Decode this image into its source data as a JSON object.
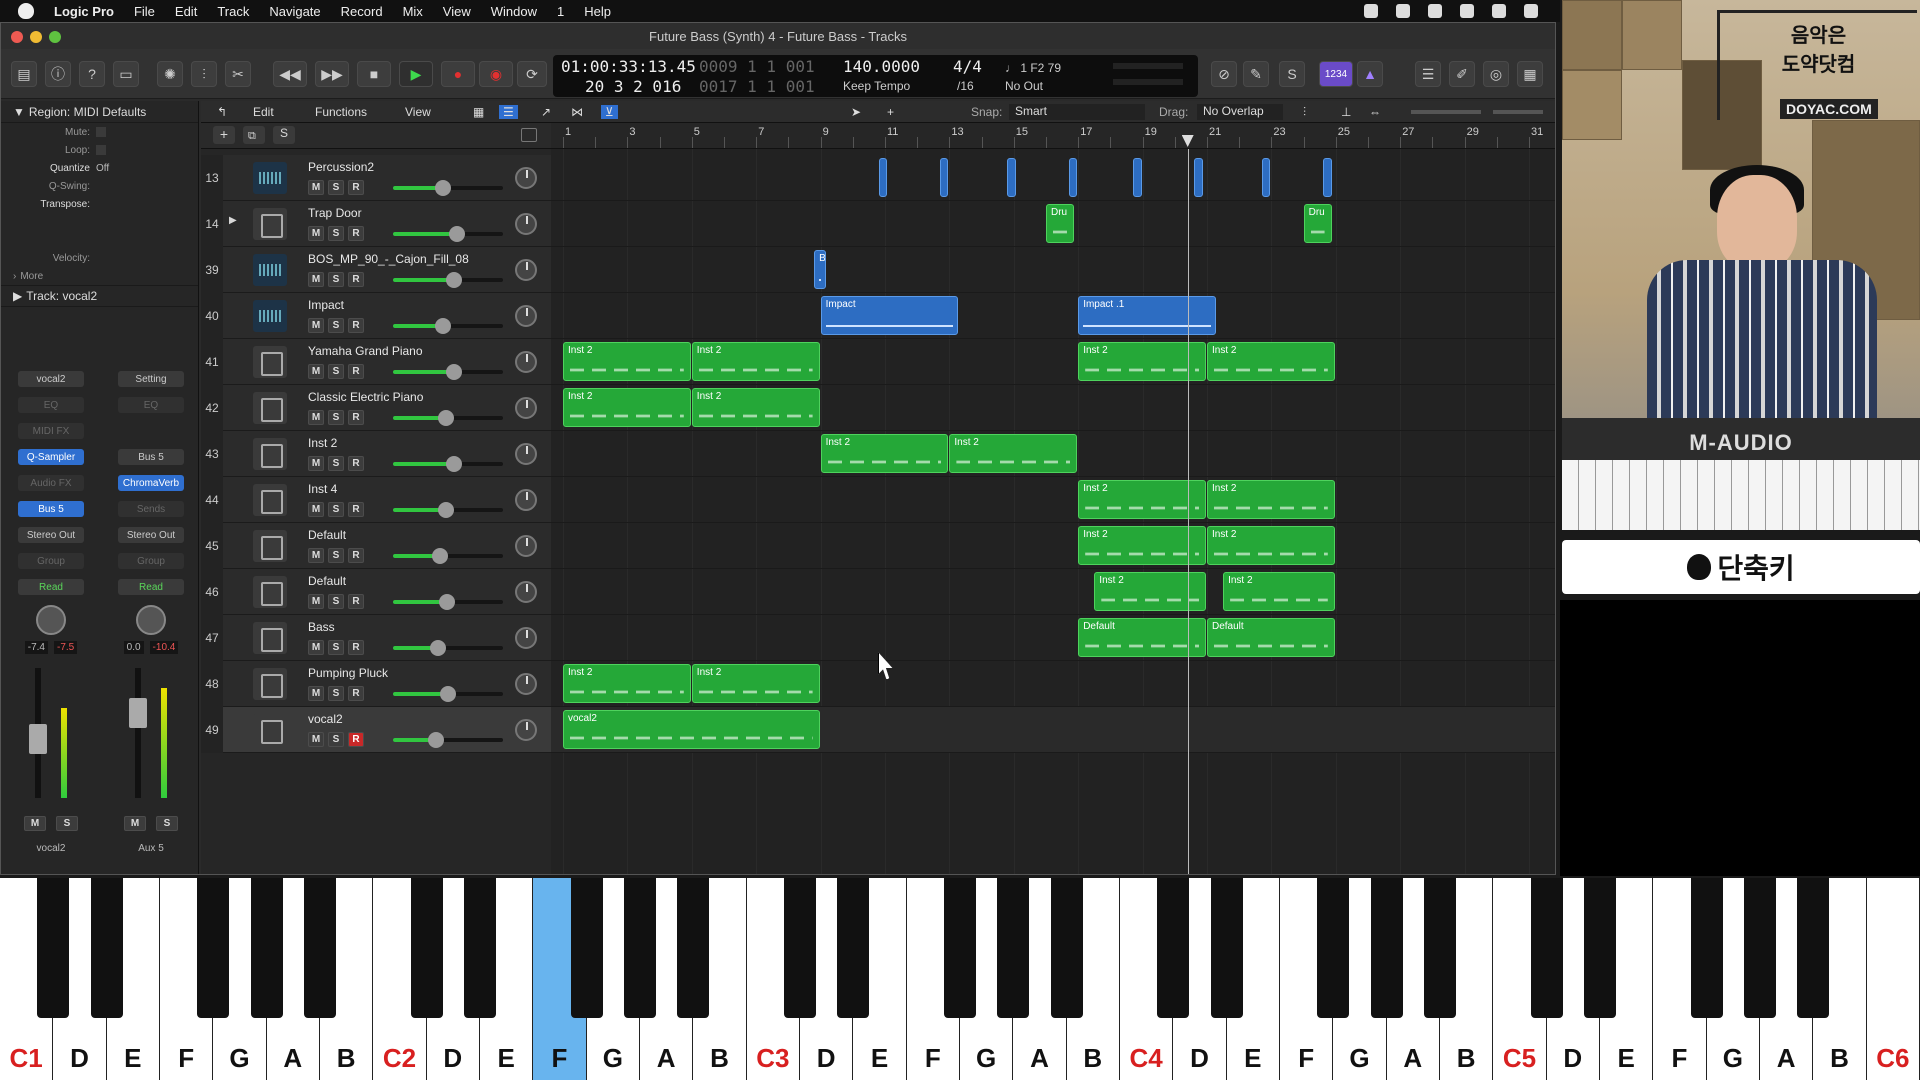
{
  "menubar": {
    "app": "Logic Pro",
    "items": [
      "File",
      "Edit",
      "Track",
      "Navigate",
      "Record",
      "Mix",
      "View",
      "Window",
      "1",
      "Help"
    ]
  },
  "window": {
    "title": "Future Bass (Synth) 4 - Future Bass - Tracks"
  },
  "lcd": {
    "smpte": "01:00:33:13.45",
    "bars_dim": "0009 1 1 001",
    "position": "20 3 2 016",
    "end_dim": "0017 1 1 001",
    "tempo": "140.0000",
    "tempo_mode": "Keep Tempo",
    "time_sig": "4/4",
    "division": "/16",
    "note_info": "♩ 1 F2 79",
    "midi_out": "No Out"
  },
  "toolbar": {
    "count_in": "1234"
  },
  "inspector": {
    "region_header": "Region: MIDI Defaults",
    "rows": [
      {
        "label": "Mute:",
        "value": ""
      },
      {
        "label": "Loop:",
        "value": ""
      },
      {
        "label": "Quantize",
        "value": "Off"
      },
      {
        "label": "Q-Swing:",
        "value": ""
      },
      {
        "label": "Transpose:",
        "value": ""
      },
      {
        "label": "Velocity:",
        "value": ""
      }
    ],
    "more": "More",
    "track_header": "Track:  vocal2",
    "strip_left": {
      "setting": "vocal2",
      "eq": "EQ",
      "midifx": "MIDI FX",
      "instrument": "Q-Sampler",
      "audiofx": "Audio FX",
      "send": "Bus 5",
      "output": "Stereo Out",
      "group": "Group",
      "automation": "Read",
      "vol": "-7.4",
      "peak": "-7.5",
      "m": "M",
      "s": "S",
      "name": "vocal2"
    },
    "strip_right": {
      "setting": "Setting",
      "eq": "EQ",
      "input": "Bus 5",
      "plugin": "ChromaVerb",
      "sends": "Sends",
      "output": "Stereo Out",
      "group": "Group",
      "automation": "Read",
      "vol": "0.0",
      "peak": "-10.4",
      "m": "M",
      "s": "S",
      "name": "Aux 5"
    }
  },
  "track_toolbar": {
    "edit": "Edit",
    "functions": "Functions",
    "view": "View",
    "snap_label": "Snap:",
    "snap_value": "Smart",
    "drag_label": "Drag:",
    "drag_value": "No Overlap"
  },
  "header_buttons": {
    "add": "+",
    "s": "S"
  },
  "ruler": {
    "bars": [
      "1",
      "3",
      "5",
      "7",
      "9",
      "11",
      "13",
      "15",
      "17",
      "19",
      "21",
      "23",
      "25",
      "27",
      "29",
      "31"
    ]
  },
  "tracks": [
    {
      "num": "13",
      "name": "Percussion2",
      "icon": "audio-waveform-icon",
      "fader": 0.45,
      "rec": false,
      "selected": false
    },
    {
      "num": "14",
      "name": "Trap Door",
      "icon": "drum-machine-icon",
      "fader": 0.58,
      "rec": false,
      "selected": false,
      "folder": true
    },
    {
      "num": "39",
      "name": "BOS_MP_90_-_Cajon_Fill_08",
      "icon": "audio-waveform-icon",
      "fader": 0.55,
      "rec": false,
      "selected": false
    },
    {
      "num": "40",
      "name": "Impact",
      "icon": "audio-waveform-icon",
      "fader": 0.45,
      "rec": false,
      "selected": false
    },
    {
      "num": "41",
      "name": "Yamaha Grand Piano",
      "icon": "grand-piano-icon",
      "fader": 0.55,
      "rec": false,
      "selected": false
    },
    {
      "num": "42",
      "name": "Classic Electric Piano",
      "icon": "electric-piano-icon",
      "fader": 0.48,
      "rec": false,
      "selected": false
    },
    {
      "num": "43",
      "name": "Inst 2",
      "icon": "synth-stand-icon",
      "fader": 0.55,
      "rec": false,
      "selected": false
    },
    {
      "num": "44",
      "name": "Inst 4",
      "icon": "synth-stand-icon",
      "fader": 0.48,
      "rec": false,
      "selected": false
    },
    {
      "num": "45",
      "name": "Default",
      "icon": "synth-stand-icon",
      "fader": 0.43,
      "rec": false,
      "selected": false
    },
    {
      "num": "46",
      "name": "Default",
      "icon": "synth-stand-icon",
      "fader": 0.49,
      "rec": false,
      "selected": false
    },
    {
      "num": "47",
      "name": "Bass",
      "icon": "synth-stand-icon",
      "fader": 0.41,
      "rec": false,
      "selected": false
    },
    {
      "num": "48",
      "name": "Pumping Pluck",
      "icon": "synth-stand-icon",
      "fader": 0.5,
      "rec": false,
      "selected": false
    },
    {
      "num": "49",
      "name": "vocal2",
      "icon": "sampler-icon",
      "fader": 0.39,
      "rec": true,
      "selected": true
    }
  ],
  "track_buttons": {
    "m": "M",
    "s": "S",
    "r": "R"
  },
  "regions": [
    {
      "track": 0,
      "name": "",
      "color": "blue",
      "start": 10.8,
      "len": 0.3
    },
    {
      "track": 0,
      "name": "",
      "color": "blue",
      "start": 12.7,
      "len": 0.3
    },
    {
      "track": 0,
      "name": "",
      "color": "blue",
      "start": 14.8,
      "len": 0.3
    },
    {
      "track": 0,
      "name": "",
      "color": "blue",
      "start": 16.7,
      "len": 0.3
    },
    {
      "track": 0,
      "name": "",
      "color": "blue",
      "start": 18.7,
      "len": 0.3
    },
    {
      "track": 0,
      "name": "",
      "color": "blue",
      "start": 20.6,
      "len": 0.3
    },
    {
      "track": 0,
      "name": "",
      "color": "blue",
      "start": 22.7,
      "len": 0.3
    },
    {
      "track": 0,
      "name": "",
      "color": "blue",
      "start": 24.6,
      "len": 0.3
    },
    {
      "track": 1,
      "name": "Dru",
      "color": "green",
      "start": 16.0,
      "len": 0.9
    },
    {
      "track": 1,
      "name": "Dru",
      "color": "green",
      "start": 24.0,
      "len": 0.9
    },
    {
      "track": 2,
      "name": "B",
      "color": "blue",
      "start": 8.8,
      "len": 0.4
    },
    {
      "track": 3,
      "name": "Impact",
      "color": "blue",
      "start": 9.0,
      "len": 4.3
    },
    {
      "track": 3,
      "name": "Impact .1",
      "color": "blue",
      "start": 17.0,
      "len": 4.3
    },
    {
      "track": 4,
      "name": "Inst 2",
      "color": "green",
      "start": 1.0,
      "len": 4.0
    },
    {
      "track": 4,
      "name": "Inst 2",
      "color": "green",
      "start": 5.0,
      "len": 4.0
    },
    {
      "track": 4,
      "name": "Inst 2",
      "color": "green",
      "start": 17.0,
      "len": 4.0
    },
    {
      "track": 4,
      "name": "Inst 2",
      "color": "green",
      "start": 21.0,
      "len": 4.0
    },
    {
      "track": 5,
      "name": "Inst 2",
      "color": "green",
      "start": 1.0,
      "len": 4.0
    },
    {
      "track": 5,
      "name": "Inst 2",
      "color": "green",
      "start": 5.0,
      "len": 4.0
    },
    {
      "track": 6,
      "name": "Inst 2",
      "color": "green",
      "start": 9.0,
      "len": 4.0
    },
    {
      "track": 6,
      "name": "Inst 2",
      "color": "green",
      "start": 13.0,
      "len": 4.0
    },
    {
      "track": 7,
      "name": "Inst 2",
      "color": "green",
      "start": 17.0,
      "len": 4.0
    },
    {
      "track": 7,
      "name": "Inst 2",
      "color": "green",
      "start": 21.0,
      "len": 4.0
    },
    {
      "track": 8,
      "name": "Inst 2",
      "color": "green",
      "start": 17.0,
      "len": 4.0
    },
    {
      "track": 8,
      "name": "Inst 2",
      "color": "green",
      "start": 21.0,
      "len": 4.0
    },
    {
      "track": 9,
      "name": "Inst 2",
      "color": "green",
      "start": 17.5,
      "len": 3.5
    },
    {
      "track": 9,
      "name": "Inst 2",
      "color": "green",
      "start": 21.5,
      "len": 3.5
    },
    {
      "track": 10,
      "name": "Default",
      "color": "green",
      "start": 17.0,
      "len": 4.0
    },
    {
      "track": 10,
      "name": "Default",
      "color": "green",
      "start": 21.0,
      "len": 4.0
    },
    {
      "track": 11,
      "name": "Inst 2",
      "color": "green",
      "start": 1.0,
      "len": 4.0
    },
    {
      "track": 11,
      "name": "Inst 2",
      "color": "green",
      "start": 5.0,
      "len": 4.0
    },
    {
      "track": 12,
      "name": "vocal2",
      "color": "green",
      "start": 1.0,
      "len": 8.0
    }
  ],
  "playhead_bar": 20.4,
  "webcam": {
    "watermark_line1": "음악은",
    "watermark_line2": "도약닷컴",
    "watermark_domain": "DOYAC.COM",
    "keyboard_brand": "M-AUDIO"
  },
  "shortcut_panel": {
    "text": "단축키"
  },
  "piano": {
    "keys": [
      "C1",
      "D",
      "E",
      "F",
      "G",
      "A",
      "B",
      "C2",
      "D",
      "E",
      "F",
      "G",
      "A",
      "B",
      "C3",
      "D",
      "E",
      "F",
      "G",
      "A",
      "B",
      "C4",
      "D",
      "E",
      "F",
      "G",
      "A",
      "B",
      "C5",
      "D",
      "E",
      "F",
      "G",
      "A",
      "B",
      "C6"
    ],
    "highlight_index": 10
  }
}
